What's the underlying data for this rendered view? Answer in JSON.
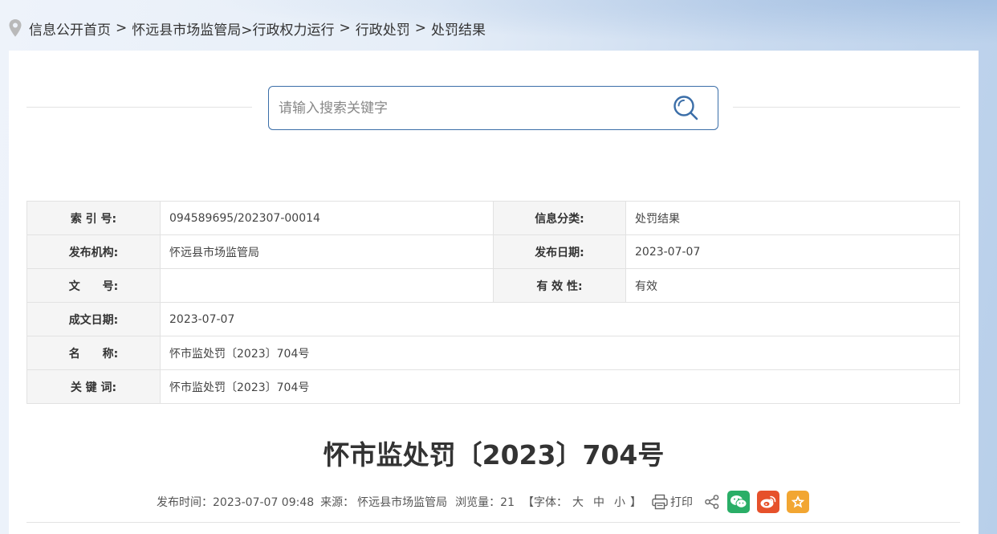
{
  "breadcrumb": {
    "items": [
      "信息公开首页",
      "怀远县市场监管局>行政权力运行",
      "行政处罚",
      "处罚结果"
    ],
    "separator": ">"
  },
  "search": {
    "placeholder": "请输入搜索关键字",
    "value": ""
  },
  "meta": {
    "index_label": "索 引 号:",
    "index_value": "094589695/202307-00014",
    "category_label": "信息分类:",
    "category_value": "处罚结果",
    "publisher_label": "发布机构:",
    "publisher_value": "怀远县市场监管局",
    "pubdate_label": "发布日期:",
    "pubdate_value": "2023-07-07",
    "docno_label": "文　　号:",
    "docno_value": "",
    "validity_label": "有 效 性:",
    "validity_value": "有效",
    "created_label": "成文日期:",
    "created_value": "2023-07-07",
    "name_label": "名　　称:",
    "name_value": "怀市监处罚〔2023〕704号",
    "keywords_label": "关 键 词:",
    "keywords_value": "怀市监处罚〔2023〕704号"
  },
  "document": {
    "title": "怀市监处罚〔2023〕704号"
  },
  "info_bar": {
    "publish_time": "发布时间：2023-07-07 09:48",
    "source_label": "来源：",
    "source_value": "怀远县市场监管局",
    "views": "浏览量：21",
    "font_open": "【字体：",
    "font_large": "大",
    "font_medium": "中",
    "font_small": "小",
    "font_close": "】",
    "print_label": "打印"
  },
  "colors": {
    "accent": "#3b6ea8",
    "wechat": "#2aae67",
    "weibo": "#e6512b",
    "favorite": "#f2a632"
  },
  "icons": [
    "location-pin-icon",
    "search-icon",
    "printer-icon",
    "share-icon",
    "wechat-icon",
    "weibo-icon",
    "star-icon"
  ]
}
